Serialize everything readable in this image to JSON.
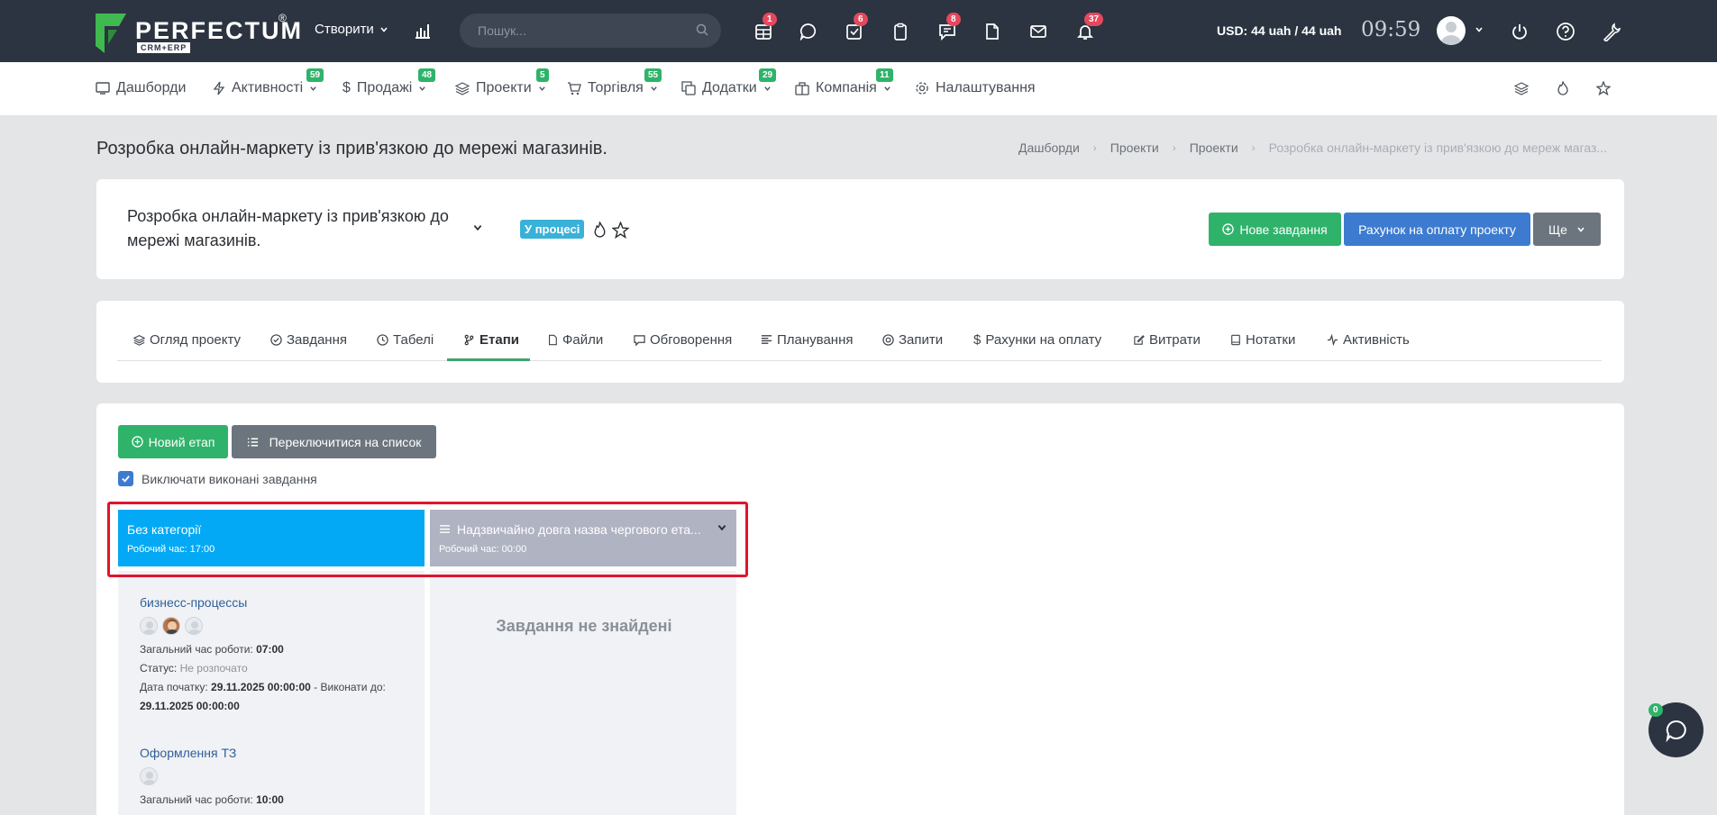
{
  "brand": {
    "name": "PERFECTUM",
    "reg": "®",
    "sub": "CRM+ERP"
  },
  "topbar": {
    "create_label": "Створити",
    "search_placeholder": "Пошук...",
    "badges": {
      "dashboard": "1",
      "tasks": "6",
      "messages": "8",
      "notifications": "37"
    },
    "currency": "USD: 44 uah / 44 uah",
    "time": "09:59"
  },
  "nav": {
    "items": [
      {
        "label": "Дашборди"
      },
      {
        "label": "Активності",
        "badge": "59"
      },
      {
        "label": "Продажі",
        "badge": "48"
      },
      {
        "label": "Проекти",
        "badge": "5"
      },
      {
        "label": "Торгівля",
        "badge": "55"
      },
      {
        "label": "Додатки",
        "badge": "29"
      },
      {
        "label": "Компанія",
        "badge": "11"
      },
      {
        "label": "Налаштування"
      }
    ]
  },
  "page": {
    "title": "Розробка онлайн-маркету із прив'язкою до мережі магазинів.",
    "breadcrumb": [
      "Дашборди",
      "Проекти",
      "Проекти",
      "Розробка онлайн-маркету із прив'язкою до мереж магаз..."
    ]
  },
  "project": {
    "name": "Розробка онлайн-маркету із прив'язкою до мережі магазинів.",
    "status": "У процесі",
    "new_task_label": "Нове завдання",
    "invoice_label": "Рахунок на оплату проекту",
    "more_label": "Ще"
  },
  "tabs": [
    {
      "label": "Огляд проекту"
    },
    {
      "label": "Завдання"
    },
    {
      "label": "Табелі"
    },
    {
      "label": "Етапи"
    },
    {
      "label": "Файли"
    },
    {
      "label": "Обговорення"
    },
    {
      "label": "Планування"
    },
    {
      "label": "Запити"
    },
    {
      "label": "Рахунки на оплату"
    },
    {
      "label": "Витрати"
    },
    {
      "label": "Нотатки"
    },
    {
      "label": "Активність"
    }
  ],
  "stages_toolbar": {
    "new_stage_label": "Новий етап",
    "switch_label": "Переключитися на список",
    "exclude_done_label": "Виключати виконані завдання",
    "exclude_done_checked": true
  },
  "stages": [
    {
      "name": "Без категорії",
      "hours": "Робочий час: 17:00",
      "color": "#03a9f4"
    },
    {
      "name": "Надзвичайно довга назва чергового ета...",
      "hours": "Робочий час: 00:00",
      "color": "#b0b3c2"
    }
  ],
  "tasks": [
    {
      "title": "бизнесс-процессы",
      "total_label": "Загальний час роботи:",
      "total": "07:00",
      "status_label": "Статус:",
      "status": "Не розпочато",
      "start_label": "Дата початку:",
      "start": "29.11.2025 00:00:00",
      "due_label": "- Виконати до:",
      "due": "29.11.2025 00:00:00"
    },
    {
      "title": "Оформлення ТЗ",
      "total_label": "Загальний час роботи:",
      "total": "10:00"
    }
  ],
  "empty_stage_text": "Завдання не знайдені",
  "chat": {
    "badge": "0"
  },
  "colors": {
    "topbar": "#2b3440",
    "success": "#2fb36a",
    "primary": "#3c7bd0",
    "secondary": "#6c757d",
    "highlight": "#e0142b"
  }
}
